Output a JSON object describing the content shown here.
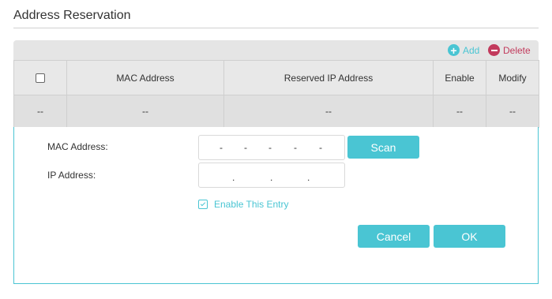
{
  "section": {
    "title": "Address Reservation"
  },
  "toolbar": {
    "add_label": "Add",
    "delete_label": "Delete"
  },
  "table": {
    "columns": [
      "MAC Address",
      "Reserved IP Address",
      "Enable",
      "Modify"
    ],
    "rows": [
      {
        "cells": [
          "--",
          "--",
          "--",
          "--",
          "--"
        ]
      }
    ]
  },
  "form": {
    "mac_label": "MAC Address:",
    "ip_label": "IP Address:",
    "mac_separator": "-",
    "ip_separator": ".",
    "scan_label": "Scan",
    "enable_label": "Enable This Entry",
    "enable_checked": true,
    "cancel_label": "Cancel",
    "ok_label": "OK"
  },
  "colors": {
    "accent": "#4ac5d3",
    "delete": "#c23a5c"
  }
}
